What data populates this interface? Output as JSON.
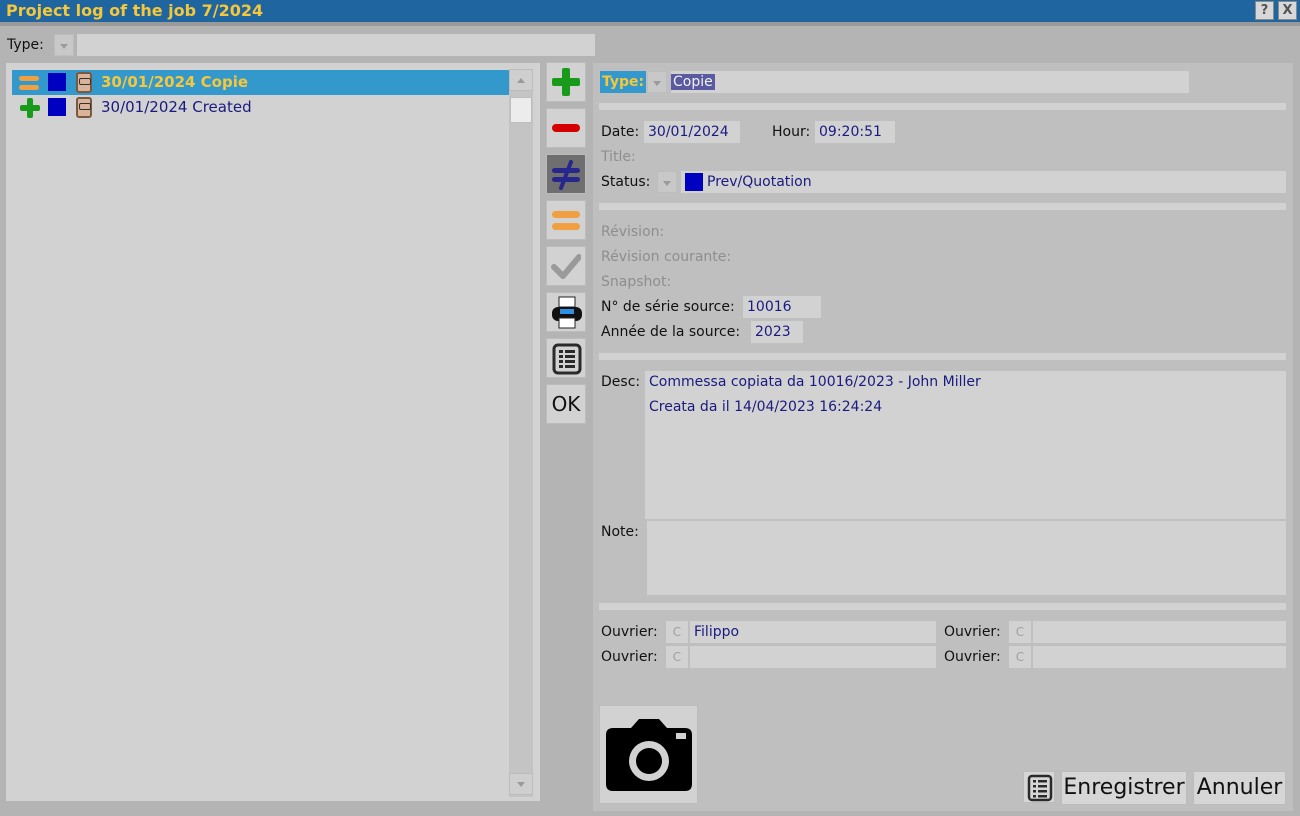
{
  "window": {
    "title": "Project log of the job 7/2024",
    "help_btn": "?",
    "close_btn": "X"
  },
  "filter": {
    "type_label": "Type:"
  },
  "log_list": [
    {
      "action_icon": "equals-icon",
      "date_text": "30/01/2024 Copie",
      "selected": true
    },
    {
      "action_icon": "plus-icon",
      "date_text": "30/01/2024 Created",
      "selected": false
    }
  ],
  "toolbar": {
    "add": "plus-icon",
    "remove": "minus-icon",
    "diff": "not-equal-icon",
    "equal": "equals-icon",
    "check": "check-icon",
    "print": "printer-icon",
    "list": "list-icon",
    "ok_label": "OK"
  },
  "detail": {
    "type_label": "Type:",
    "type_value": "Copie",
    "date_label": "Date:",
    "date_value": "30/01/2024",
    "hour_label": "Hour:",
    "hour_value": "09:20:51",
    "title_label": "Title:",
    "status_label": "Status:",
    "status_value": "Prev/Quotation",
    "revision_label": "Révision:",
    "current_revision_label": "Révision courante:",
    "snapshot_label": "Snapshot:",
    "source_serial_label": "N° de série source:",
    "source_serial_value": "10016",
    "source_year_label": "Année de la source:",
    "source_year_value": "2023",
    "desc_label": "Desc:",
    "desc_lines": [
      "Commessa copiata da 10016/2023 - John Miller",
      "Creata da  il 14/04/2023 16:24:24"
    ],
    "note_label": "Note:",
    "workers": [
      {
        "label": "Ouvrier:",
        "c": "C",
        "value": "Filippo"
      },
      {
        "label": "Ouvrier:",
        "c": "C",
        "value": ""
      },
      {
        "label": "Ouvrier:",
        "c": "C",
        "value": ""
      },
      {
        "label": "Ouvrier:",
        "c": "C",
        "value": ""
      }
    ],
    "save_label": "Enregistrer",
    "cancel_label": "Annuler"
  },
  "colors": {
    "titlebar_bg": "#1f66a0",
    "title_text": "#f6c73a",
    "selection_bg": "#3399cc",
    "value_text": "#1a1a80",
    "status_square": "#0000c0",
    "add_green": "#1a9a1a",
    "remove_red": "#d40000",
    "equal_orange": "#f0a040"
  }
}
